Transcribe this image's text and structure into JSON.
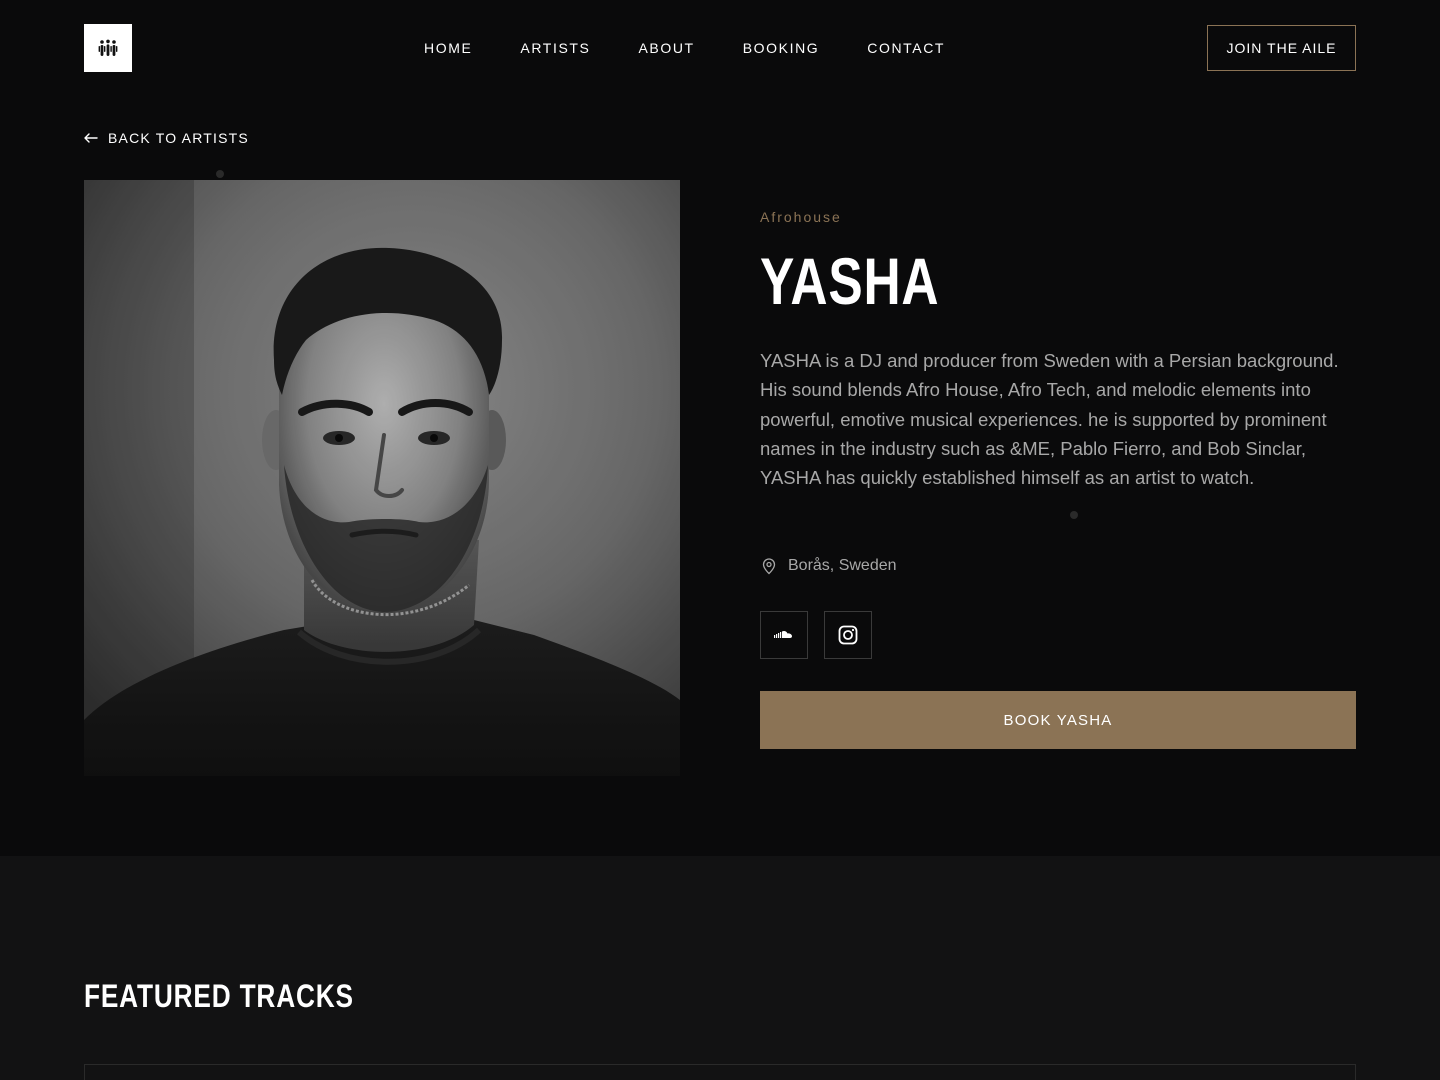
{
  "header": {
    "nav": [
      "HOME",
      "ARTISTS",
      "ABOUT",
      "BOOKING",
      "CONTACT"
    ],
    "cta_label": "JOIN THE AILE"
  },
  "back_link": "BACK TO ARTISTS",
  "artist": {
    "genre": "Afrohouse",
    "name": "YASHA",
    "bio": "YASHA is a DJ and producer from Sweden with a Persian background. His sound blends Afro House, Afro Tech, and melodic elements into powerful, emotive musical experiences. he is supported by prominent names in the industry such as &ME, Pablo Fierro, and Bob Sinclar, YASHA has quickly established himself as an artist to watch.",
    "location": "Borås, Sweden",
    "socials": [
      {
        "icon": "soundcloud-icon"
      },
      {
        "icon": "instagram-icon"
      }
    ],
    "book_label": "BOOK YASHA"
  },
  "featured": {
    "title": "FEATURED TRACKS"
  },
  "colors": {
    "background": "#0a0a0b",
    "section_bg": "#121213",
    "accent": "#8b7355",
    "text": "#ffffff",
    "muted_text": "#a8a8a8"
  }
}
